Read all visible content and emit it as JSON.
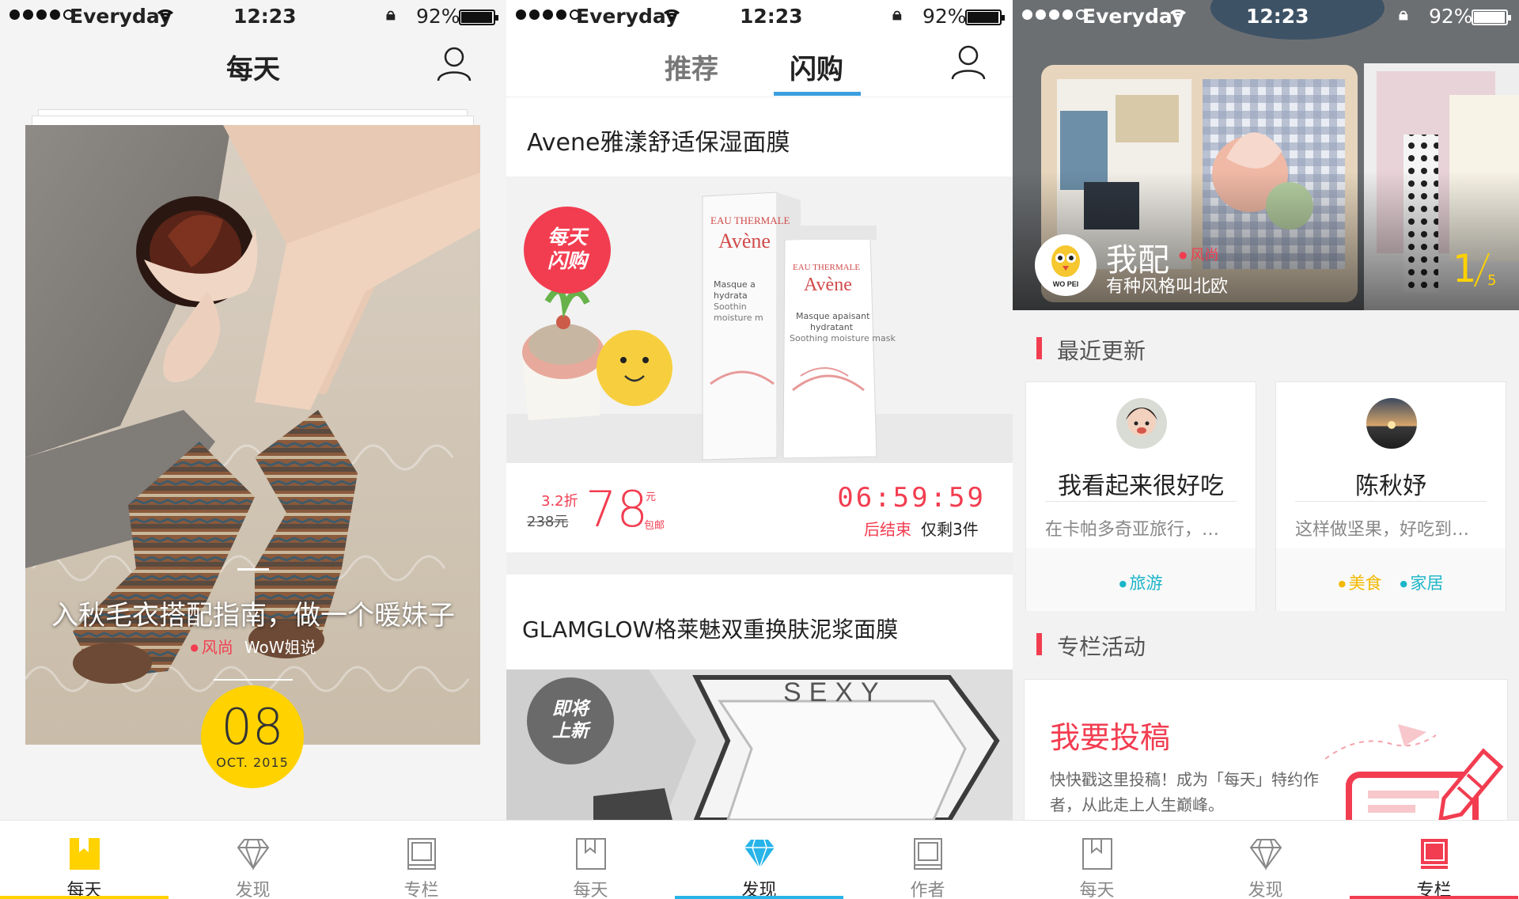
{
  "colors": {
    "accent_red": "#f23d50",
    "accent_yellow": "#ffd200",
    "accent_blue": "#3b9ee0",
    "tag_cyan": "#1bb5c9",
    "tag_orange": "#f4b800"
  },
  "status_bar": {
    "carrier": "Everyday",
    "time": "12:23",
    "battery": "92%",
    "battery_level": 0.92
  },
  "screen1": {
    "title": "每天",
    "headline": "入秋毛衣搭配指南，做一个暖妹子",
    "category": "风尚",
    "author": "WoW姐说",
    "date_day": "08",
    "date_month": "OCT. 2015"
  },
  "screen2": {
    "tabs": [
      {
        "label": "推荐",
        "active": false
      },
      {
        "label": "闪购",
        "active": true
      }
    ],
    "item1": {
      "title": "Avene雅漾舒适保湿面膜",
      "badge": "每天闪购",
      "badge_line1": "每天",
      "badge_line2": "闪购",
      "discount": "3.2折",
      "original_price": "238元",
      "price": "78",
      "price_unit": "元",
      "shipping": "包邮",
      "countdown": "06:59:59",
      "countdown_label": "后结束",
      "stock": "仅剩3件",
      "product_text": {
        "box_brand": "EAU THERMALE",
        "box_name": "Avène",
        "tube_brand": "EAU THERMALE",
        "tube_name": "Avène",
        "tube_desc1": "Masque apaisant",
        "tube_desc2": "hydratant",
        "tube_desc3": "Soothing moisture mask",
        "box_desc1": "Masque a",
        "box_desc2": "hydrata",
        "box_desc3": "Soothin",
        "box_desc4": "moisture m"
      }
    },
    "item2": {
      "title": "GLAMGLOW格莱魅双重换肤泥浆面膜",
      "badge_line1": "即将",
      "badge_line2": "上新",
      "product_text": "SEXY"
    }
  },
  "screen3": {
    "hero": {
      "title": "我配",
      "tag": "风尚",
      "subtitle": "有种风格叫北欧",
      "page_current": "1",
      "page_total": "5",
      "logo_text": "WO PEI"
    },
    "recent_title": "最近更新",
    "authors": [
      {
        "name": "我看起来很好吃",
        "excerpt": "在卡帕多奇亚旅行，…",
        "tags": [
          {
            "label": "旅游",
            "color": "#1bb5c9"
          }
        ]
      },
      {
        "name": "陈秋妤",
        "excerpt": "这样做坚果，好吃到…",
        "tags": [
          {
            "label": "美食",
            "color": "#f4b800"
          },
          {
            "label": "家居",
            "color": "#1bb5c9"
          }
        ]
      }
    ],
    "activity_title": "专栏活动",
    "submit": {
      "title": "我要投稿",
      "desc": "快快戳这里投稿！成为「每天」特约作者，从此走上人生巅峰。"
    }
  },
  "tabbars": {
    "screen1": [
      {
        "label": "每天",
        "icon": "bookmark-icon",
        "active": true
      },
      {
        "label": "发现",
        "icon": "diamond-icon",
        "active": false
      },
      {
        "label": "专栏",
        "icon": "book-icon",
        "active": false
      }
    ],
    "screen2": [
      {
        "label": "每天",
        "icon": "bookmark-icon",
        "active": false
      },
      {
        "label": "发现",
        "icon": "diamond-icon",
        "active": true
      },
      {
        "label": "作者",
        "icon": "book-icon",
        "active": false
      }
    ],
    "screen3": [
      {
        "label": "每天",
        "icon": "bookmark-icon",
        "active": false
      },
      {
        "label": "发现",
        "icon": "diamond-icon",
        "active": false
      },
      {
        "label": "专栏",
        "icon": "book-icon",
        "active": true
      }
    ]
  }
}
